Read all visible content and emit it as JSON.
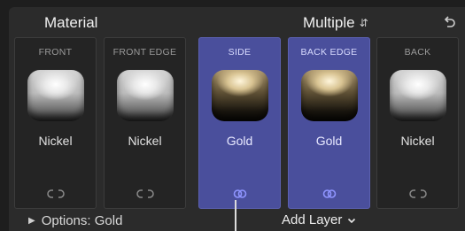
{
  "header": {
    "title": "Material",
    "mode_value": "Multiple",
    "mode_icon": "updown-chevron-icon",
    "reset_icon": "undo-icon"
  },
  "tiles": [
    {
      "label": "FRONT",
      "value": "Nickel",
      "material": "nickel",
      "active": false,
      "link_icon": "unlinked-icon"
    },
    {
      "label": "FRONT EDGE",
      "value": "Nickel",
      "material": "nickel",
      "active": false,
      "link_icon": "unlinked-icon"
    },
    {
      "label": "SIDE",
      "value": "Gold",
      "material": "gold",
      "active": true,
      "link_icon": "linked-icon"
    },
    {
      "label": "BACK EDGE",
      "value": "Gold",
      "material": "gold",
      "active": true,
      "link_icon": "linked-icon"
    },
    {
      "label": "BACK",
      "value": "Nickel",
      "material": "nickel",
      "active": false,
      "link_icon": "unlinked-icon"
    }
  ],
  "footer": {
    "options_label": "Options: Gold",
    "add_layer_label": "Add Layer"
  },
  "colors": {
    "active_tile": "#4a4f9c",
    "link_active": "#8f95ff",
    "link_inactive": "#8a8a8a"
  }
}
